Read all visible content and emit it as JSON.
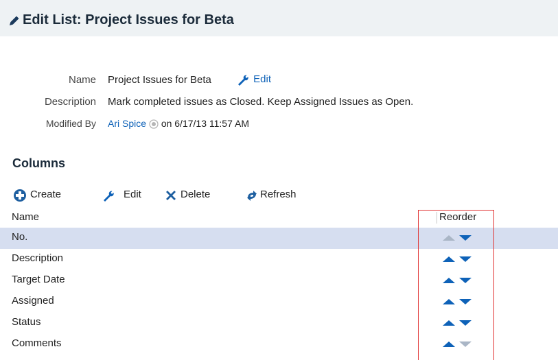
{
  "header": {
    "title": "Edit List: Project Issues for Beta",
    "icon": "pencil-icon"
  },
  "properties": {
    "name_label": "Name",
    "name_value": "Project Issues for Beta",
    "edit_link": "Edit",
    "description_label": "Description",
    "description_value": "Mark completed issues as Closed. Keep Assigned Issues as Open.",
    "modified_label": "Modified By",
    "modified_user": "Ari Spice",
    "modified_date": "on 6/17/13 11:57 AM"
  },
  "columns_section": {
    "title": "Columns",
    "toolbar": {
      "create": "Create",
      "edit": "Edit",
      "delete": "Delete",
      "refresh": "Refresh"
    },
    "header": {
      "name": "Name",
      "reorder": "Reorder"
    },
    "rows": [
      {
        "name": "No.",
        "selected": true,
        "up_enabled": false,
        "down_enabled": true
      },
      {
        "name": "Description",
        "selected": false,
        "up_enabled": true,
        "down_enabled": true
      },
      {
        "name": "Target Date",
        "selected": false,
        "up_enabled": true,
        "down_enabled": true
      },
      {
        "name": "Assigned",
        "selected": false,
        "up_enabled": true,
        "down_enabled": true
      },
      {
        "name": "Status",
        "selected": false,
        "up_enabled": true,
        "down_enabled": true
      },
      {
        "name": "Comments",
        "selected": false,
        "up_enabled": true,
        "down_enabled": false
      }
    ]
  },
  "colors": {
    "accent": "#0e62b8",
    "selected_row": "#d6def0",
    "highlight_box": "#e03030",
    "disabled_arrow": "#aab6c6"
  }
}
